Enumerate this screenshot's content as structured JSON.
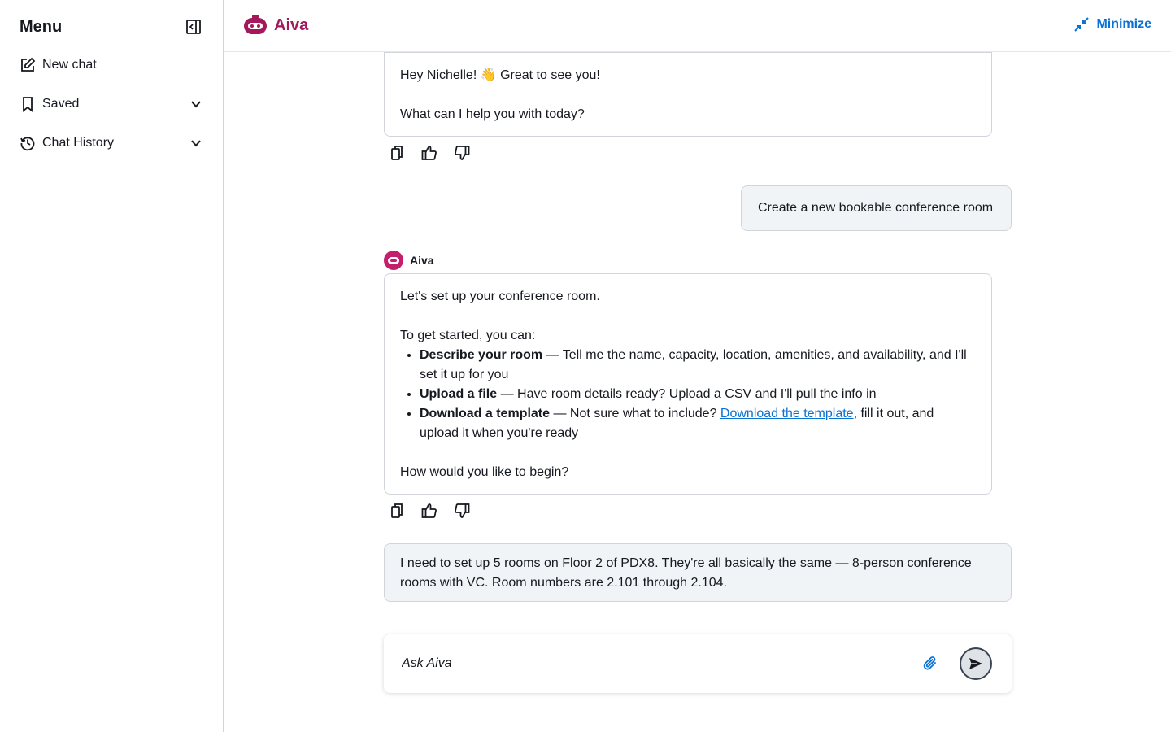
{
  "sidebar": {
    "title": "Menu",
    "items": [
      {
        "label": "New chat",
        "icon": "edit-icon"
      },
      {
        "label": "Saved",
        "icon": "bookmark-icon",
        "expandable": true
      },
      {
        "label": "Chat History",
        "icon": "history-icon",
        "expandable": true
      }
    ]
  },
  "header": {
    "brand": "Aiva",
    "minimize_label": "Minimize"
  },
  "colors": {
    "brand": "#a3195b",
    "link": "#0972d3"
  },
  "messages": {
    "greeting": {
      "line1": "Hey Nichelle! 👋 Great to see you!",
      "line2": "What can I help you with today?"
    },
    "user1": "Create a new bookable conference room",
    "bot_name": "Aiva",
    "reply": {
      "intro": "Let's set up your conference room.",
      "lead": "To get started, you can:",
      "options": [
        {
          "title": "Describe your room",
          "text": " — Tell me the name, capacity, location, amenities, and availability, and I'll set it up for you"
        },
        {
          "title": "Upload a file",
          "text": " — Have room details ready? Upload a CSV and I'll pull the info in"
        },
        {
          "title": "Download a template",
          "pre": " — Not sure what to include? ",
          "link": "Download the template",
          "post": ", fill it out, and upload it when you're ready"
        }
      ],
      "closing": "How would you like to begin?"
    },
    "user2": "I need to set up 5 rooms on Floor 2 of PDX8. They're all basically the same — 8-person conference rooms with VC. Room numbers are 2.101 through 2.104."
  },
  "composer": {
    "placeholder": "Ask Aiva"
  }
}
